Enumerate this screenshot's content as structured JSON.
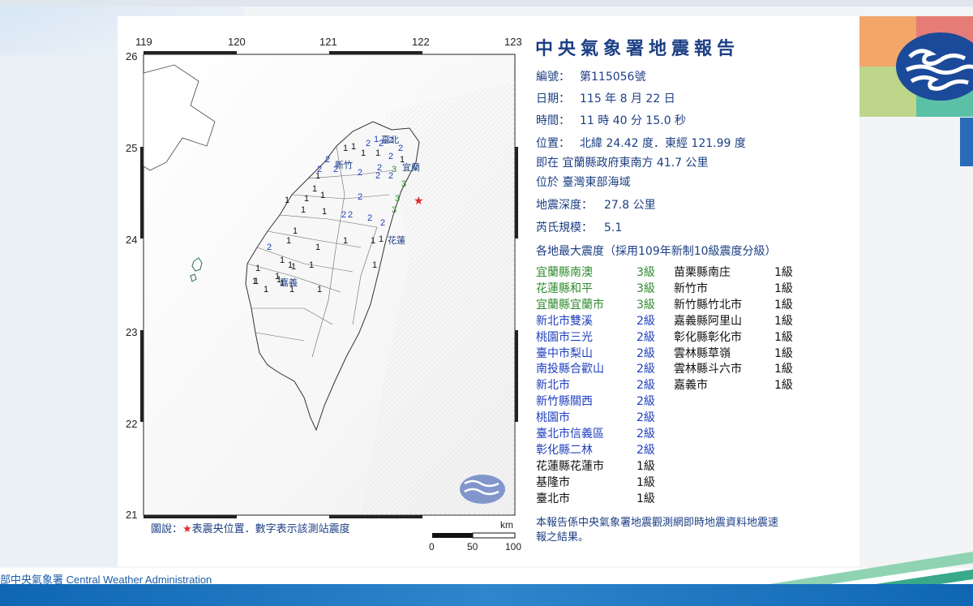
{
  "report": {
    "title": "中央氣象署地震報告",
    "number_label": "編號：",
    "number_value": "第115056號",
    "date_label": "日期：",
    "date_value": "115 年 8 月 22 日",
    "time_label": "時間：",
    "time_value": "11 時 40 分 15.0 秒",
    "location_label": "位置：",
    "location_value": "北緯 24.42 度．東經 121.99 度",
    "relative_position": "即在 宜蘭縣政府東南方 41.7 公里",
    "region": "位於 臺灣東部海域",
    "depth_label": "地震深度：",
    "depth_value": "27.8 公里",
    "magnitude_label": "芮氏規模：",
    "magnitude_value": "5.1",
    "intensity_heading": "各地最大震度（採用109年新制10級震度分級）",
    "note": "本報告係中央氣象署地震觀測網即時地震資料地震速報之結果。"
  },
  "stations_left": [
    {
      "name": "宜蘭縣南澳",
      "level": "3級",
      "color": "#2e8b2e"
    },
    {
      "name": "花蓮縣和平",
      "level": "3級",
      "color": "#2e8b2e"
    },
    {
      "name": "宜蘭縣宜蘭市",
      "level": "3級",
      "color": "#2e8b2e"
    },
    {
      "name": "新北市雙溪",
      "level": "2級",
      "color": "#1f3fbf"
    },
    {
      "name": "桃園市三光",
      "level": "2級",
      "color": "#1f3fbf"
    },
    {
      "name": "臺中市梨山",
      "level": "2級",
      "color": "#1f3fbf"
    },
    {
      "name": "南投縣合歡山",
      "level": "2級",
      "color": "#1f3fbf"
    },
    {
      "name": "新北市",
      "level": "2級",
      "color": "#1f3fbf"
    },
    {
      "name": "新竹縣關西",
      "level": "2級",
      "color": "#1f3fbf"
    },
    {
      "name": "桃園市",
      "level": "2級",
      "color": "#1f3fbf"
    },
    {
      "name": "臺北市信義區",
      "level": "2級",
      "color": "#1f3fbf"
    },
    {
      "name": "彰化縣二林",
      "level": "2級",
      "color": "#1f3fbf"
    },
    {
      "name": "花蓮縣花蓮市",
      "level": "1級",
      "color": "#111111"
    },
    {
      "name": "基隆市",
      "level": "1級",
      "color": "#111111"
    },
    {
      "name": "臺北市",
      "level": "1級",
      "color": "#111111"
    }
  ],
  "stations_right": [
    {
      "name": "苗栗縣南庄",
      "level": "1級",
      "color": "#111111"
    },
    {
      "name": "新竹市",
      "level": "1級",
      "color": "#111111"
    },
    {
      "name": "新竹縣竹北市",
      "level": "1級",
      "color": "#111111"
    },
    {
      "name": "嘉義縣阿里山",
      "level": "1級",
      "color": "#111111"
    },
    {
      "name": "彰化縣彰化市",
      "level": "1級",
      "color": "#111111"
    },
    {
      "name": "雲林縣草嶺",
      "level": "1級",
      "color": "#111111"
    },
    {
      "name": "雲林縣斗六市",
      "level": "1級",
      "color": "#111111"
    },
    {
      "name": "嘉義市",
      "level": "1級",
      "color": "#111111"
    }
  ],
  "map": {
    "lon_ticks": [
      "119",
      "120",
      "121",
      "122",
      "123"
    ],
    "lat_ticks": [
      "26",
      "25",
      "24",
      "23",
      "22",
      "21"
    ],
    "city_labels": [
      "臺北",
      "新竹",
      "宜蘭",
      "花蓮",
      "嘉義"
    ],
    "legend_prefix": "圖說：",
    "legend_star": "★",
    "legend_text": "表震央位置．數字表示該測站震度",
    "scale_unit": "km",
    "scale_ticks": [
      "0",
      "50",
      "100"
    ],
    "epicenter_color": "#e12b2b"
  },
  "footer": {
    "org_text": "部中央氣象署 Central Weather Administration"
  }
}
